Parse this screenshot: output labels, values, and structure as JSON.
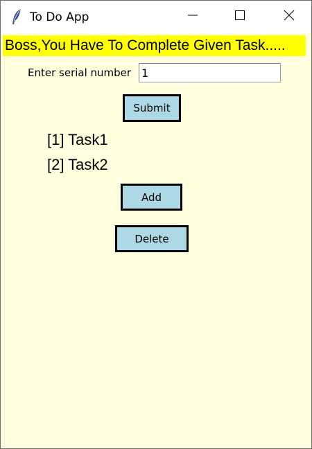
{
  "window": {
    "title": "To Do App",
    "icon": "feather-icon",
    "controls": [
      "minimize-icon",
      "maximize-icon",
      "close-icon"
    ]
  },
  "banner": {
    "text": "Boss,You Have To Complete Given Task.....",
    "background": "#ffff00"
  },
  "serial": {
    "label": "Enter serial number",
    "value": "1"
  },
  "buttons": {
    "submit": "Submit",
    "add": "Add",
    "delete": "Delete"
  },
  "tasks": [
    {
      "text": "[1] Task1"
    },
    {
      "text": "[2] Task2"
    }
  ],
  "colors": {
    "window_background": "#ffffe0",
    "button_background": "#add8e6",
    "button_border": "#000000"
  }
}
